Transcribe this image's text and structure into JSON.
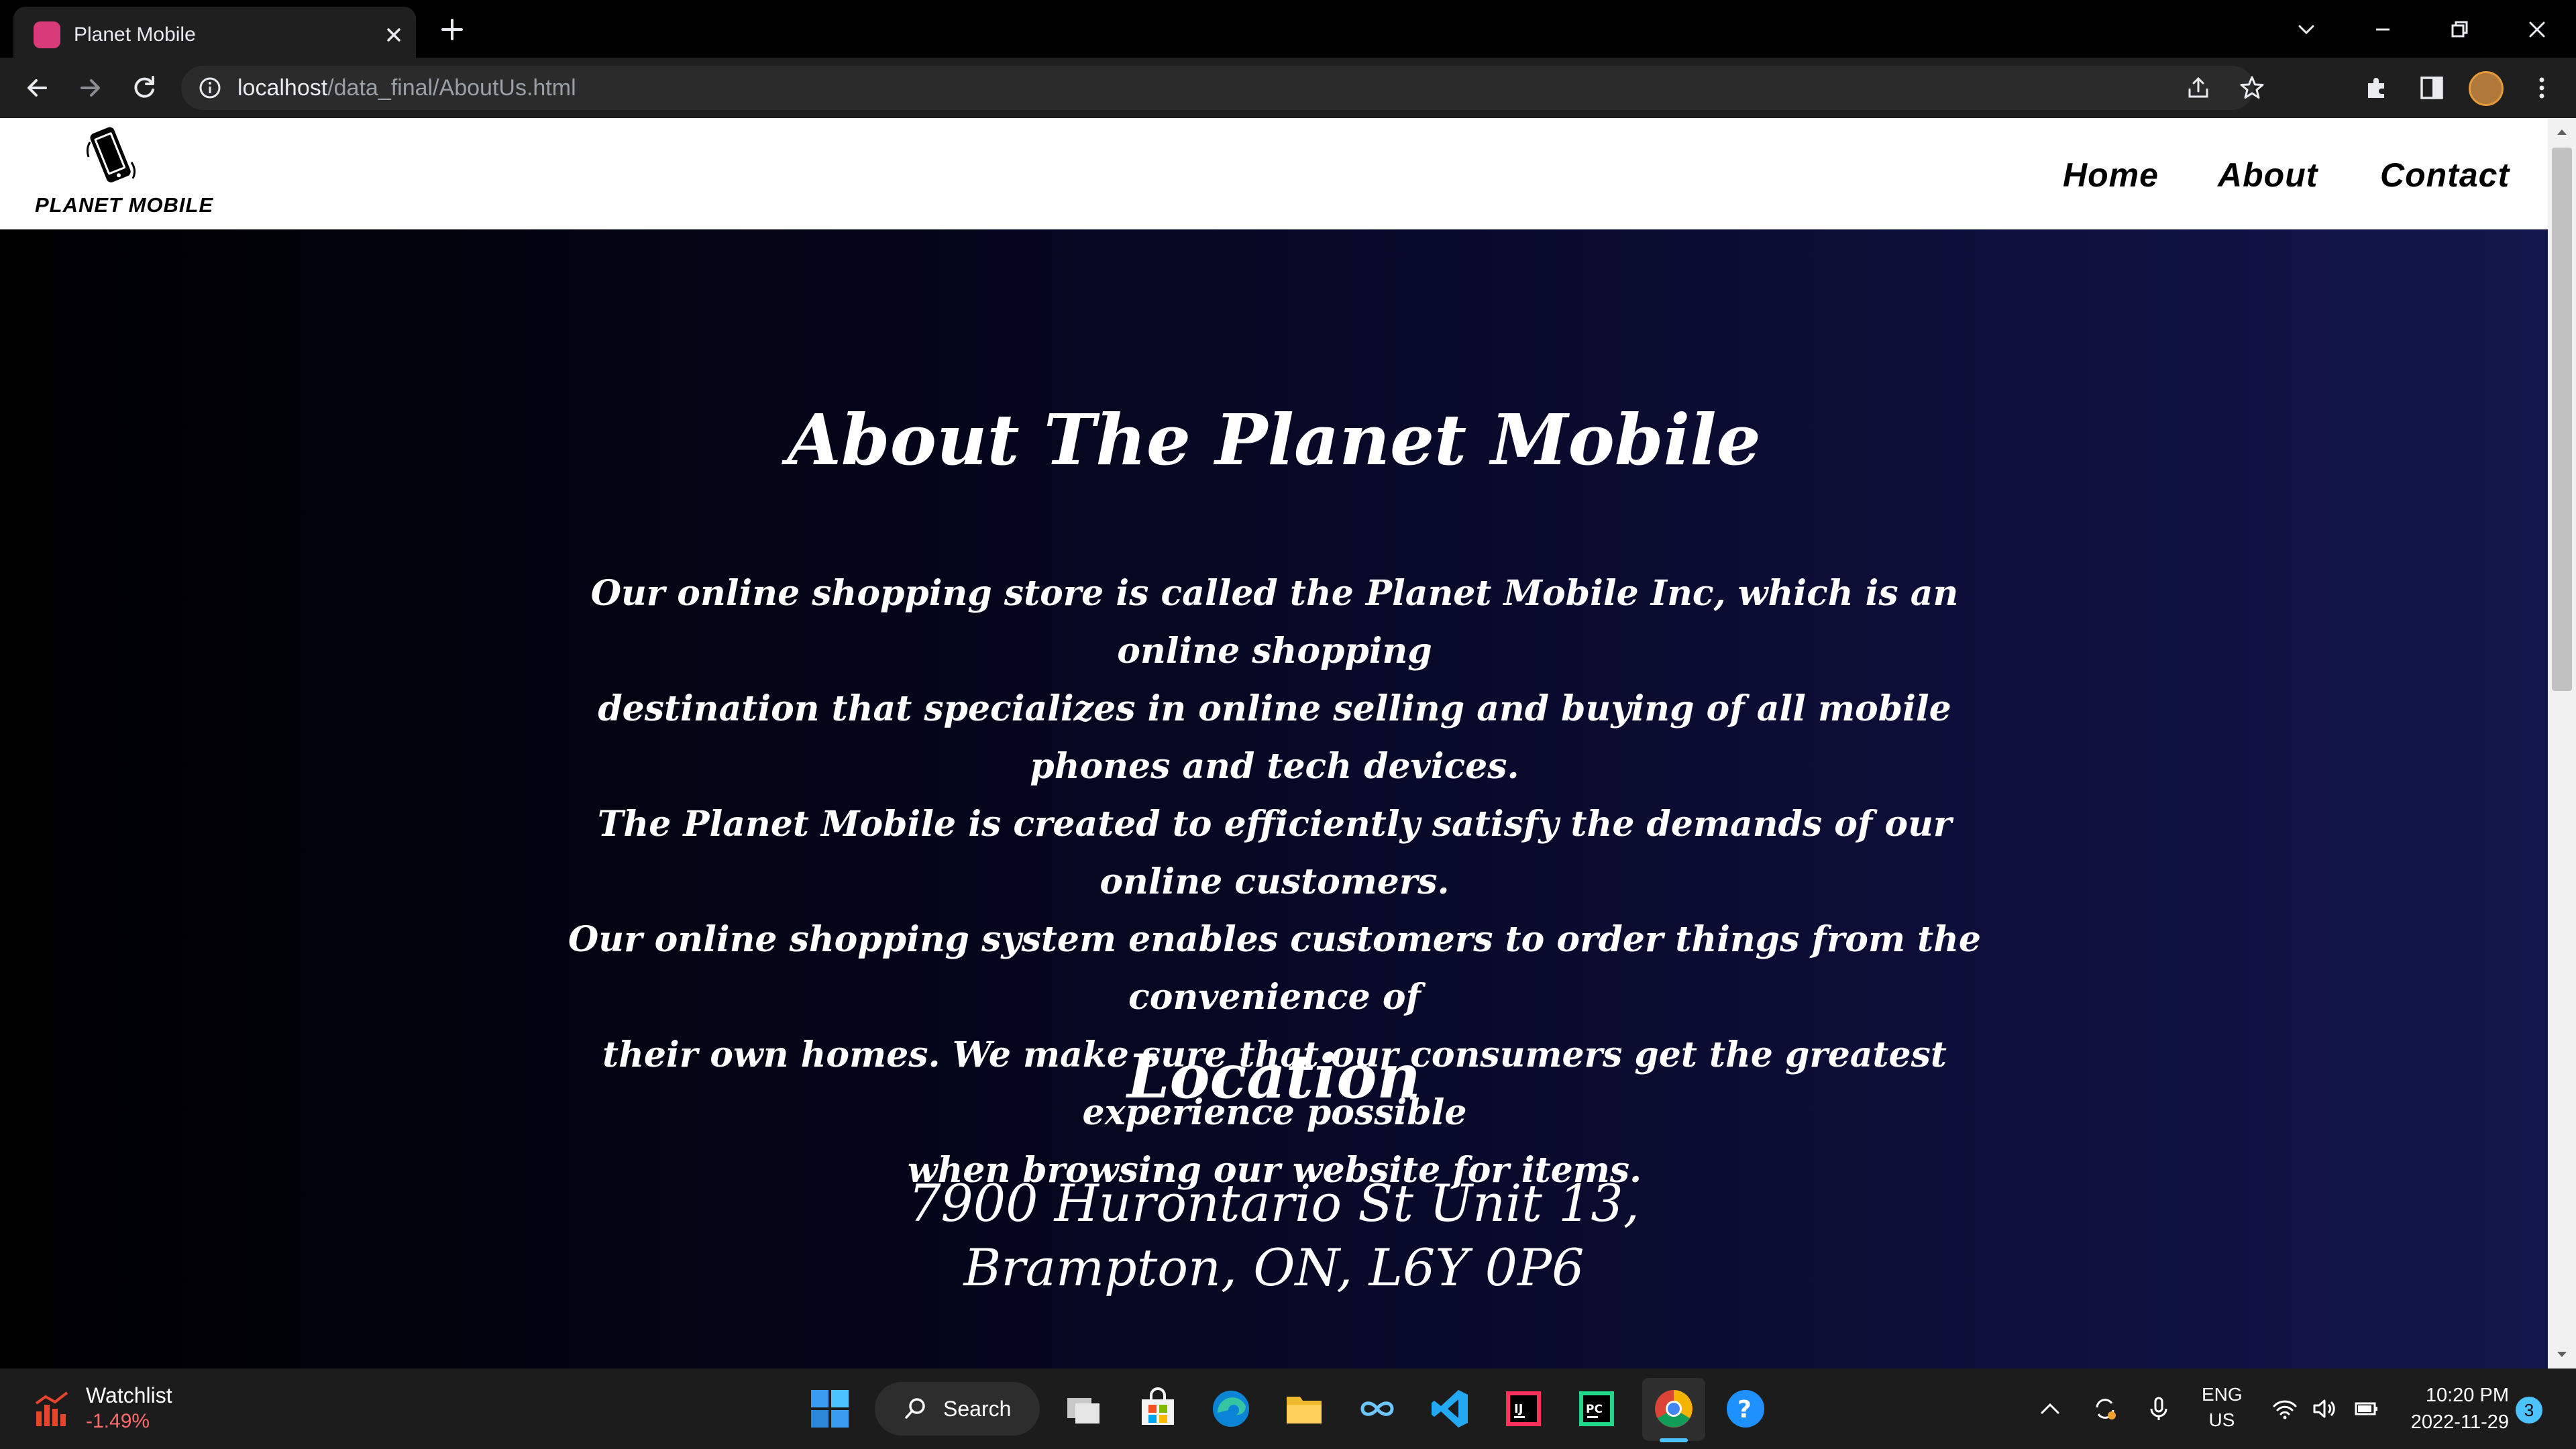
{
  "browser": {
    "tab_title": "Planet Mobile",
    "url_host": "localhost",
    "url_path": "/data_final/AboutUs.html"
  },
  "site": {
    "logo_text": "PLANET MOBILE",
    "nav": {
      "home": "Home",
      "about": "About",
      "contact": "Contact"
    }
  },
  "about": {
    "title": "About The Planet Mobile",
    "paragraph_lines": [
      "Our online shopping store is called the Planet Mobile Inc, which is an online shopping",
      "destination that specializes in online selling and buying of all mobile phones and tech devices.",
      "The Planet Mobile is created to efficiently satisfy the demands of our online customers.",
      "Our online shopping system enables customers to order things from the convenience of",
      "their own homes. We make sure that our consumers get the greatest experience possible",
      "when browsing our website for items."
    ]
  },
  "location": {
    "title": "Location",
    "address_line1": "7900 Hurontario St Unit 13,",
    "address_line2": "Brampton, ON, L6Y 0P6"
  },
  "taskbar": {
    "widget_title": "Watchlist",
    "widget_value": "-1.49%",
    "search_label": "Search",
    "lang_line1": "ENG",
    "lang_line2": "US",
    "time": "10:20 PM",
    "date": "2022-11-29",
    "notification_count": "3"
  },
  "colors": {
    "page_gradient_start": "#000000",
    "page_gradient_end": "#12164a",
    "header_bg": "#ffffff",
    "accent_blue": "#4cc2ff",
    "widget_negative": "#ff6b6b"
  }
}
